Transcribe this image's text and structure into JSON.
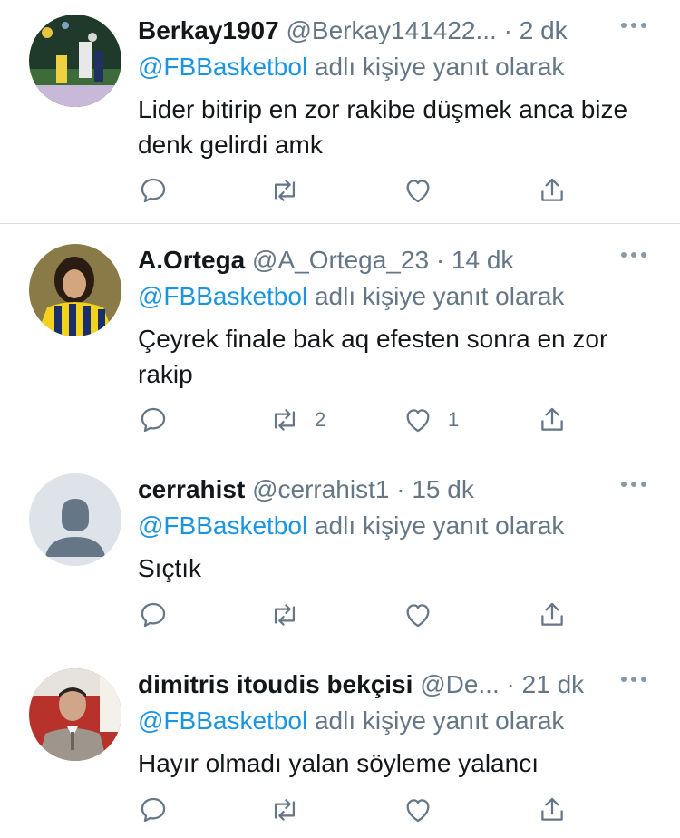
{
  "colors": {
    "accent": "#1b95e0",
    "muted": "#657786",
    "text": "#14171a",
    "divider": "#d8dde1"
  },
  "tweets": [
    {
      "name": "Berkay1907",
      "handle": "@Berkay141422...",
      "sep": "·",
      "time": "2 dk",
      "reply_prefix": "@FBBasketbol",
      "reply_suffix": " adlı kişiye yanıt olarak",
      "text": "Lider bitirip en zor rakibe düşmek anca bize denk gelirdi amk",
      "retweets": "",
      "likes": ""
    },
    {
      "name": "A.Ortega",
      "handle": "@A_Ortega_23",
      "sep": "·",
      "time": "14 dk",
      "reply_prefix": "@FBBasketbol",
      "reply_suffix": " adlı kişiye yanıt olarak",
      "text": "Çeyrek finale bak aq efesten sonra en zor rakip",
      "retweets": "2",
      "likes": "1"
    },
    {
      "name": "cerrahist",
      "handle": "@cerrahist1",
      "sep": "·",
      "time": "15 dk",
      "reply_prefix": "@FBBasketbol",
      "reply_suffix": " adlı kişiye yanıt olarak",
      "text": "Sıçtık",
      "retweets": "",
      "likes": ""
    },
    {
      "name": "dimitris itoudis bekçisi",
      "handle": "@De...",
      "sep": "·",
      "time": "21 dk",
      "reply_prefix": "@FBBasketbol",
      "reply_suffix": " adlı kişiye yanıt olarak",
      "text": "Hayır olmadı yalan söyleme yalancı",
      "retweets": "",
      "likes": ""
    }
  ]
}
